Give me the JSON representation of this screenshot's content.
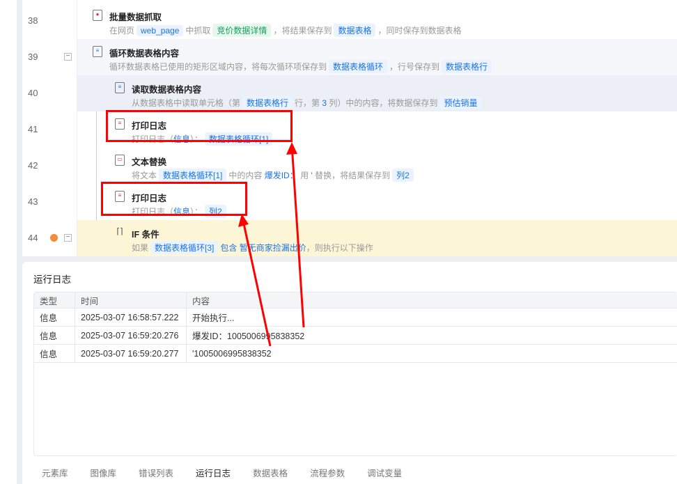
{
  "flow": {
    "rows": [
      {
        "num": "38",
        "title": "批量数据抓取",
        "d1": "在网页",
        "t1": "web_page",
        "d2": "中抓取",
        "t2": "竞价数据详情",
        "d3": "，将结果保存到",
        "t3": "数据表格",
        "d4": "，同时保存到数据表格"
      },
      {
        "num": "39",
        "title": "循环数据表格内容",
        "d1": "循环数据表格已使用的矩形区域内容，将每次循环项保存到",
        "t1": "数据表格循环",
        "d2": "，行号保存到",
        "t2": "数据表格行"
      },
      {
        "num": "40",
        "title": "读取数据表格内容",
        "d1": "从数据表格中读取单元格（第",
        "t1": "数据表格行",
        "d2": "行，第",
        "k1": "3",
        "d3": "列）中的内容，将数据保存到",
        "t2": "预估销量"
      },
      {
        "num": "41",
        "title": "打印日志",
        "d1": "打印日志（",
        "k1": "信息",
        "d2": "）：",
        "t1": "数据表格循环[1]"
      },
      {
        "num": "42",
        "title": "文本替换",
        "d1": "将文本",
        "t1": "数据表格循环[1]",
        "d2": "中的内容",
        "k1": "爆发ID：",
        "d3": "用",
        "k2": "'",
        "d4": "替换，将结果保存到",
        "t2": "列2"
      },
      {
        "num": "43",
        "title": "打印日志",
        "d1": "打印日志（",
        "k1": "信息",
        "d2": "）：",
        "t1": "列2"
      },
      {
        "num": "44",
        "title": "IF 条件",
        "d1": "如果",
        "t1": "数据表格循环[3]",
        "k1": "包含",
        "k2": "暂无商家捡漏出价",
        "d2": "，则执行以下操作"
      }
    ]
  },
  "log": {
    "title": "运行日志",
    "headers": [
      "类型",
      "时间",
      "内容"
    ],
    "rows": [
      [
        "信息",
        "2025-03-07 16:58:57.222",
        "开始执行..."
      ],
      [
        "信息",
        "2025-03-07 16:59:20.276",
        "爆发ID：1005006995838352"
      ],
      [
        "信息",
        "2025-03-07 16:59:20.277",
        "'1005006995838352"
      ]
    ]
  },
  "tabs": [
    "元素库",
    "图像库",
    "错误列表",
    "运行日志",
    "数据表格",
    "流程参数",
    "调试变量"
  ],
  "colors": {
    "annotation": "#ff0000",
    "tag_bg": "#eaf3ff",
    "tag_text": "#1a73e8",
    "highlight_row": "#fdf6d6"
  }
}
